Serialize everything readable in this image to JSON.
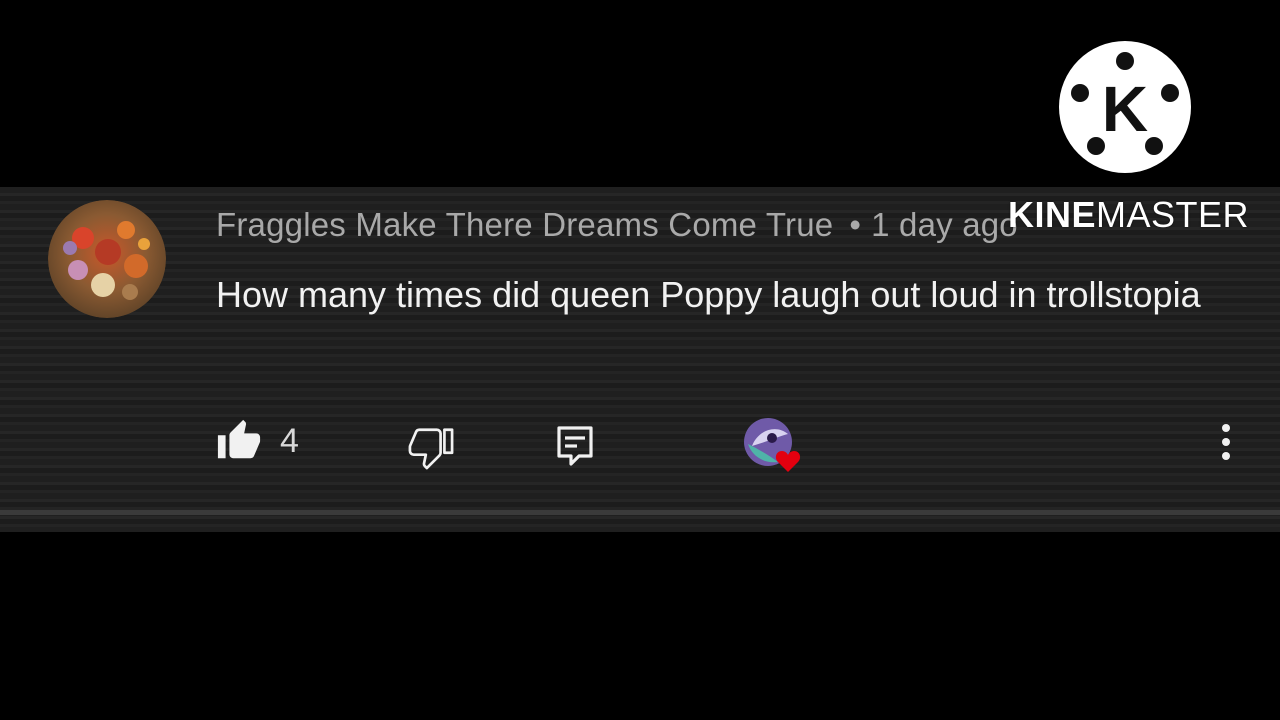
{
  "comment": {
    "author": "Fraggles Make There Dreams Come True",
    "separator": "•",
    "time": "1 day ago",
    "text": "How many times did queen Poppy laugh out loud in trollstopia",
    "likes": "4"
  },
  "icons": {
    "like": "thumbs-up-icon",
    "dislike": "thumbs-down-icon",
    "reply": "reply-icon",
    "creator_heart": "creator-heart-icon",
    "more": "more-vert-icon"
  },
  "watermark": {
    "logo_letter": "K",
    "brand_bold": "KINE",
    "brand_rest": "MASTER"
  },
  "colors": {
    "background": "#000000",
    "card": "#212121",
    "author_text": "#a9a9a9",
    "comment_text": "#f1f1f1",
    "heart": "#e3000f"
  }
}
